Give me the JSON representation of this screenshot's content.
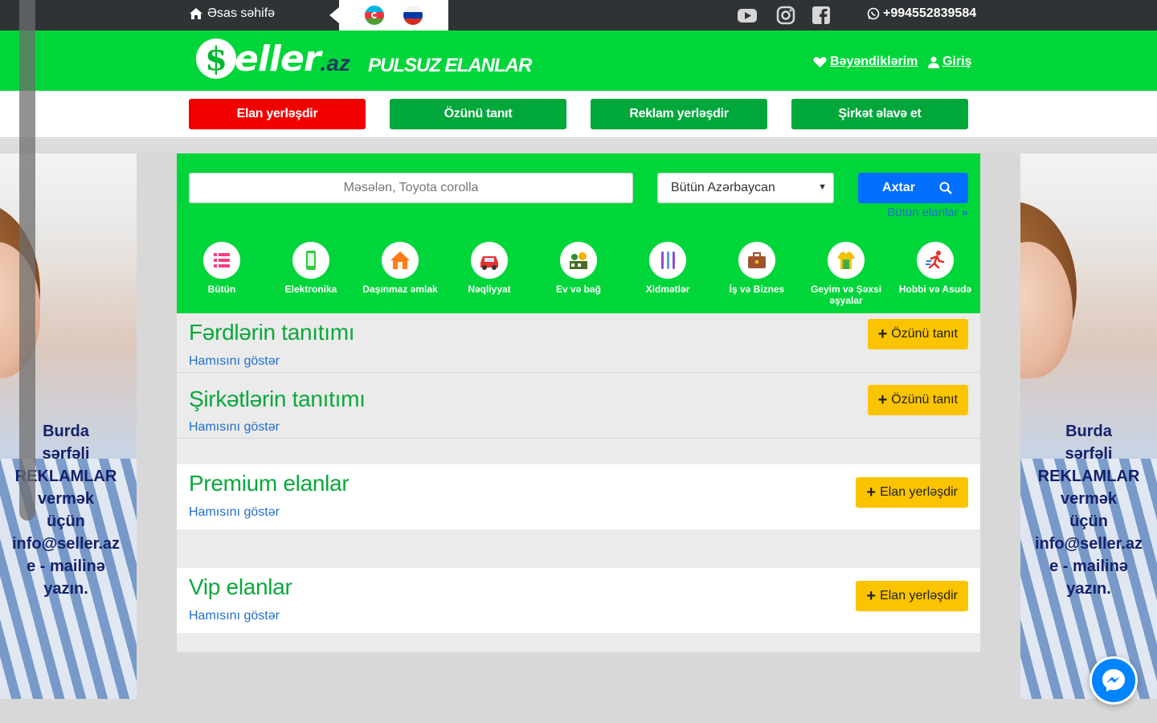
{
  "topbar": {
    "home_label": "Əsas səhifə",
    "phone": "+994552839584",
    "languages": [
      "az",
      "ru"
    ],
    "social": [
      "youtube-icon",
      "instagram-icon",
      "facebook-icon"
    ]
  },
  "header": {
    "logo_main": "eller",
    "logo_coin": "$",
    "logo_suffix": ".az",
    "tagline": "PULSUZ ELANLAR",
    "favorites_label": "Bəyəndiklərim",
    "login_label": "Giriş"
  },
  "actions": {
    "post_ad": "Elan yerləşdir",
    "introduce_self": "Özünü tanıt",
    "post_advert": "Reklam yerləşdir",
    "add_company": "Şirkət əlavə et"
  },
  "search": {
    "placeholder": "Məsələn, Toyota corolla",
    "region_selected": "Bütün Azərbaycan",
    "search_label": "Axtar",
    "all_ads_label": "Bütün elanlar"
  },
  "categories": [
    {
      "label": "Bütün",
      "icon": "list-icon",
      "color": "#ff3d7f"
    },
    {
      "label": "Elektronika",
      "icon": "phone-icon",
      "color": "#2ecc40"
    },
    {
      "label": "Daşınmaz əmlak",
      "icon": "house-icon",
      "color": "#ff7a1a"
    },
    {
      "label": "Nəqliyyat",
      "icon": "car-icon",
      "color": "#e5322d"
    },
    {
      "label": "Ev və bağ",
      "icon": "garden-icon",
      "color": "#4a6b2a"
    },
    {
      "label": "Xidmətlər",
      "icon": "tools-icon",
      "color": "#8a4fd6"
    },
    {
      "label": "İş və Biznes",
      "icon": "briefcase-icon",
      "color": "#a0522d"
    },
    {
      "label": "Geyim və Şəxsi əşyalar",
      "icon": "clothes-icon",
      "color": "#f2c200"
    },
    {
      "label": "Hobbi və Asudə",
      "icon": "runner-icon",
      "color": "#e5322d"
    }
  ],
  "sections": {
    "individuals": {
      "title": "Fərdlərin tanıtımı",
      "link": "Hamısını göstər",
      "button": "Özünü tanıt"
    },
    "companies": {
      "title": "Şirkətlərin tanıtımı",
      "link": "Hamısını göstər",
      "button": "Özünü tanıt"
    },
    "premium": {
      "title": "Premium elanlar",
      "link": "Hamısını göstər",
      "button": "Elan yerləşdir"
    },
    "vip": {
      "title": "Vip elanlar",
      "link": "Hamısını göstər",
      "button": "Elan yerləşdir"
    }
  },
  "side_ad": {
    "lines": [
      "Burda",
      "sərfəli",
      "REKLAMLAR",
      "vermək",
      "üçün",
      "info@seller.az",
      "e - mailinə",
      "yazın."
    ]
  },
  "colors": {
    "brand_green": "#00d63a",
    "button_green": "#00a73a",
    "button_red": "#f20000",
    "accent_yellow": "#fbc400",
    "search_blue": "#006eff",
    "title_green": "#0aa83c"
  }
}
